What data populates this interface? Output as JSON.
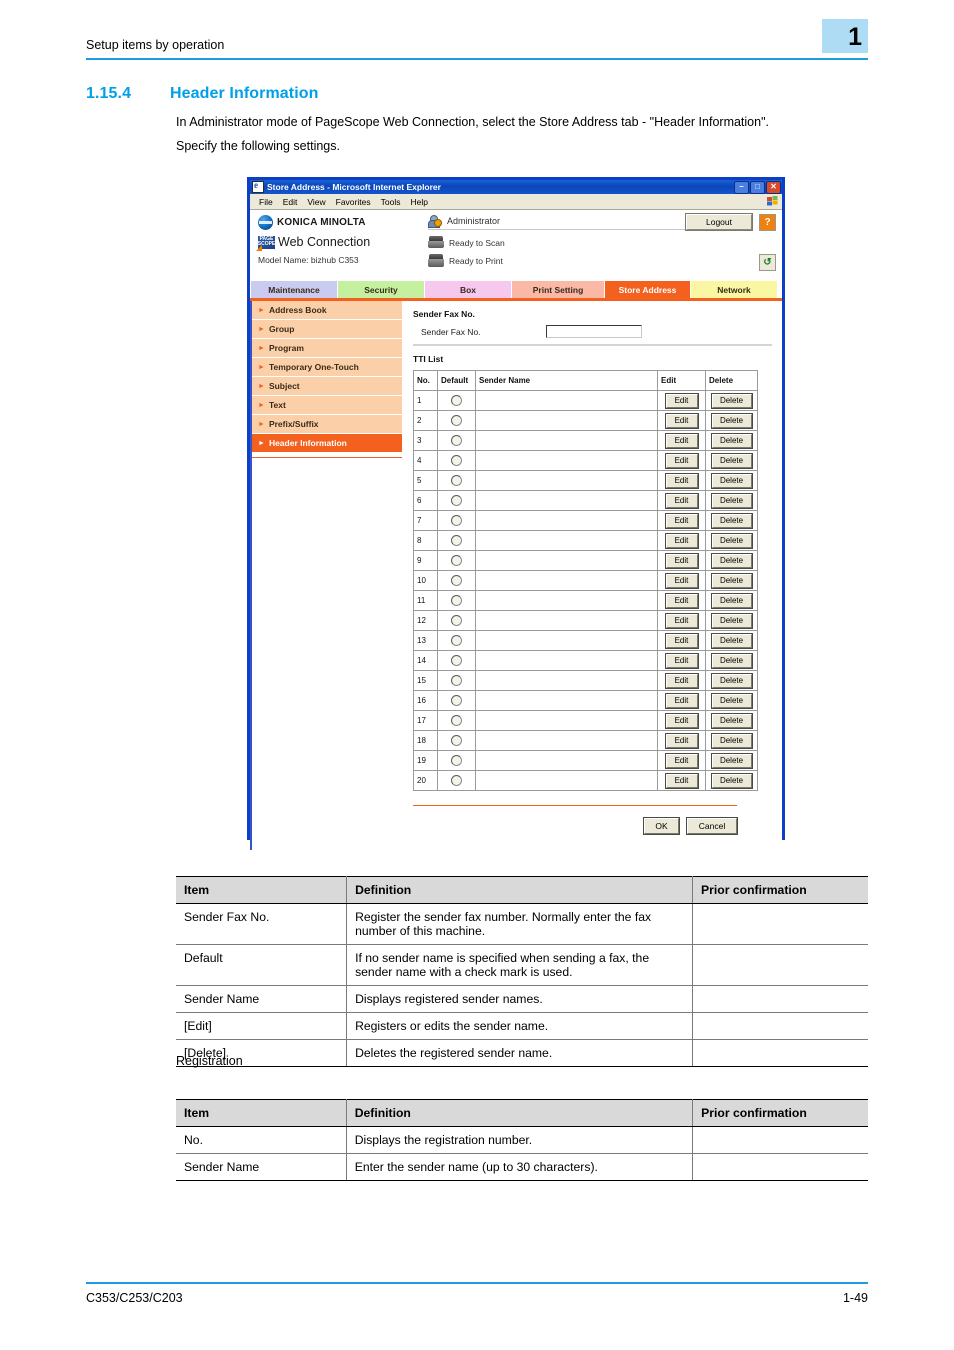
{
  "page": {
    "running_head": "Setup items by operation",
    "chapter_badge": "1",
    "footer_left": "C353/C253/C203",
    "footer_right": "1-49"
  },
  "section": {
    "number": "1.15.4",
    "title": "Header Information",
    "paragraph_1": "In Administrator mode of PageScope Web Connection, select the Store Address tab - \"Header Information\".",
    "paragraph_2": "Specify the following settings."
  },
  "browser": {
    "title": "Store Address - Microsoft Internet Explorer",
    "window_buttons": {
      "minimize": "–",
      "maximize": "□",
      "close": "✕"
    },
    "menu": [
      "File",
      "Edit",
      "View",
      "Favorites",
      "Tools",
      "Help"
    ],
    "brand": {
      "company": "KONICA MINOLTA",
      "product_mark_line1": "PAGE",
      "product_mark_line2": "SCOPE",
      "product": "Web Connection",
      "model_name": "Model Name: bizhub C353"
    },
    "user": {
      "role": "Administrator",
      "logout_label": "Logout",
      "help_label": "?"
    },
    "status": {
      "scan": "Ready to Scan",
      "print": "Ready to Print",
      "refresh_icon": "refresh-icon"
    },
    "tabs": [
      {
        "label": "Maintenance",
        "color": "#C9CCF0",
        "active": false
      },
      {
        "label": "Security",
        "color": "#C4F0A0",
        "active": false
      },
      {
        "label": "Box",
        "color": "#F7C8EE",
        "active": false
      },
      {
        "label": "Print Setting",
        "color": "#FAB9A6",
        "active": false
      },
      {
        "label": "Store Address",
        "color": "#F4601E",
        "active": true
      },
      {
        "label": "Network",
        "color": "#FBF6A2",
        "active": false
      }
    ],
    "sidebar": [
      {
        "label": "Address Book",
        "active": false
      },
      {
        "label": "Group",
        "active": false
      },
      {
        "label": "Program",
        "active": false
      },
      {
        "label": "Temporary One-Touch",
        "active": false
      },
      {
        "label": "Subject",
        "active": false
      },
      {
        "label": "Text",
        "active": false
      },
      {
        "label": "Prefix/Suffix",
        "active": false
      },
      {
        "label": "Header Information",
        "active": true
      }
    ],
    "content": {
      "sender_fax_heading": "Sender Fax No.",
      "sender_fax_label": "Sender Fax No.",
      "sender_fax_value": "",
      "tti_heading": "TTI List",
      "tti_columns": [
        "No.",
        "Default",
        "Sender Name",
        "Edit",
        "Delete"
      ],
      "edit_label": "Edit",
      "delete_label": "Delete",
      "rows": [
        {
          "no": "1",
          "sender_name": ""
        },
        {
          "no": "2",
          "sender_name": ""
        },
        {
          "no": "3",
          "sender_name": ""
        },
        {
          "no": "4",
          "sender_name": ""
        },
        {
          "no": "5",
          "sender_name": ""
        },
        {
          "no": "6",
          "sender_name": ""
        },
        {
          "no": "7",
          "sender_name": ""
        },
        {
          "no": "8",
          "sender_name": ""
        },
        {
          "no": "9",
          "sender_name": ""
        },
        {
          "no": "10",
          "sender_name": ""
        },
        {
          "no": "11",
          "sender_name": ""
        },
        {
          "no": "12",
          "sender_name": ""
        },
        {
          "no": "13",
          "sender_name": ""
        },
        {
          "no": "14",
          "sender_name": ""
        },
        {
          "no": "15",
          "sender_name": ""
        },
        {
          "no": "16",
          "sender_name": ""
        },
        {
          "no": "17",
          "sender_name": ""
        },
        {
          "no": "18",
          "sender_name": ""
        },
        {
          "no": "19",
          "sender_name": ""
        },
        {
          "no": "20",
          "sender_name": ""
        }
      ],
      "ok_label": "OK",
      "cancel_label": "Cancel"
    }
  },
  "tables": {
    "headers": [
      "Item",
      "Definition",
      "Prior confirmation"
    ],
    "table_1": [
      {
        "item": "Sender Fax No.",
        "definition": "Register the sender fax number. Normally enter the fax number of this machine.",
        "prior": ""
      },
      {
        "item": "Default",
        "definition": "If no sender name is specified when sending a fax, the sender name with a check mark is used.",
        "prior": ""
      },
      {
        "item": "Sender Name",
        "definition": "Displays registered sender names.",
        "prior": ""
      },
      {
        "item": "[Edit]",
        "definition": "Registers or edits the sender name.",
        "prior": ""
      },
      {
        "item": "[Delete]",
        "definition": "Deletes the registered sender name.",
        "prior": ""
      }
    ],
    "registration_label": "Registration",
    "table_2": [
      {
        "item": "No.",
        "definition": "Displays the registration number.",
        "prior": ""
      },
      {
        "item": "Sender Name",
        "definition": "Enter the sender name (up to 30 characters).",
        "prior": ""
      }
    ]
  }
}
